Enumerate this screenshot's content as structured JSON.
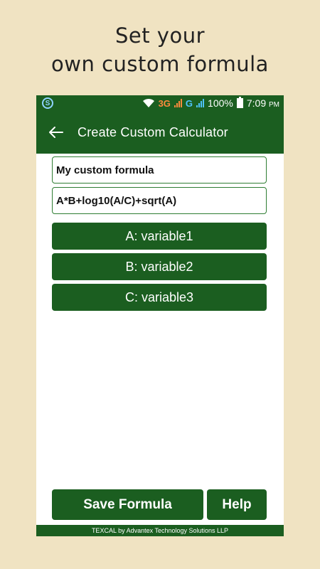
{
  "promo": {
    "line1": "Set your",
    "line2": "own custom formula"
  },
  "status_bar": {
    "network_3g": "3G",
    "network_g": "G",
    "battery_percent": "100%",
    "time": "7:09",
    "time_suffix": "PM"
  },
  "app_bar": {
    "title": "Create Custom Calculator"
  },
  "form": {
    "name_value": "My custom formula",
    "formula_value": "A*B+log10(A/C)+sqrt(A)"
  },
  "variables": [
    {
      "label": "A: variable1"
    },
    {
      "label": "B: variable2"
    },
    {
      "label": "C: variable3"
    }
  ],
  "actions": {
    "save_label": "Save Formula",
    "help_label": "Help"
  },
  "footer": {
    "text": "TEXCAL by Advantex Technology Solutions LLP"
  },
  "colors": {
    "primary": "#1b5e20",
    "background": "#f0e3c2",
    "accent_3g": "#ff8a3d",
    "accent_g": "#4fc3ff"
  }
}
